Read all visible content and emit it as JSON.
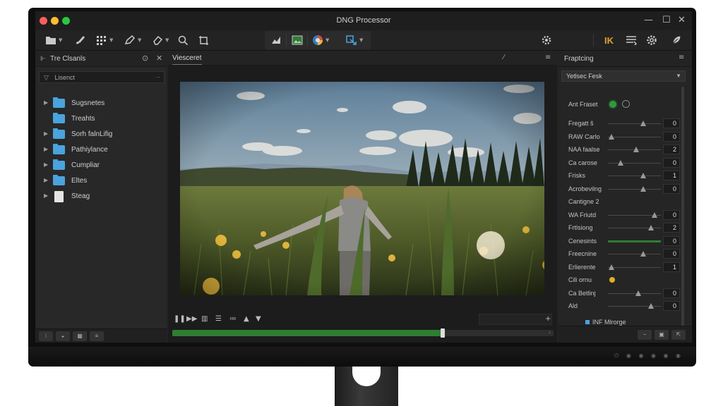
{
  "window": {
    "title": "DNG Processor",
    "controls": [
      "—",
      "☐",
      "✕"
    ]
  },
  "traffic_lights": [
    "#ff5f57",
    "#febc2e",
    "#28c840"
  ],
  "toolbar": {
    "icons_left": [
      "folder-icon",
      "brush-icon",
      "grid-icon",
      "pen-icon",
      "eraser-icon",
      "zoom-icon",
      "crop-icon"
    ],
    "icons_center": [
      "histogram-icon",
      "image-icon",
      "color-wheel-icon",
      "export-icon"
    ],
    "icons_right": [
      "settings-icon",
      "ik-logo-icon",
      "layers-icon",
      "gear-icon",
      "feather-icon"
    ],
    "ik_label": "IK"
  },
  "left_panel": {
    "title": "Tre Clsanls",
    "filter_label": "Lisenct",
    "items": [
      {
        "label": "Sugsnetes",
        "expandable": true,
        "type": "folder"
      },
      {
        "label": "Treahts",
        "expandable": false,
        "type": "folder"
      },
      {
        "label": "Sorh falnLifig",
        "expandable": true,
        "type": "folder"
      },
      {
        "label": "Pathiylance",
        "expandable": true,
        "type": "folder"
      },
      {
        "label": "Cumpliar",
        "expandable": true,
        "type": "folder"
      },
      {
        "label": "Eltes",
        "expandable": true,
        "type": "folder"
      },
      {
        "label": "Steag",
        "expandable": true,
        "type": "document"
      }
    ]
  },
  "viewer": {
    "tab_label": "Viesceret"
  },
  "playback": {
    "progress": 0.71
  },
  "right_panel": {
    "title": "Fraptcing",
    "preset_label": "Yetlsec Fesk",
    "auto_preset_label": "Ant Fraset",
    "params": [
      {
        "label": "Fregatt š",
        "value": "0",
        "pos": 0.65,
        "fill": false
      },
      {
        "label": "RAW Carlo",
        "value": "0",
        "pos": 0.02,
        "fill": false
      },
      {
        "label": "NAA faalse",
        "value": "2",
        "pos": 0.5,
        "fill": false
      },
      {
        "label": "Ca carose",
        "value": "0",
        "pos": 0.2,
        "fill": false
      },
      {
        "label": "Frisks",
        "value": "1",
        "pos": 0.65,
        "fill": false
      },
      {
        "label": "Acrobevilng",
        "value": "0",
        "pos": 0.65,
        "fill": false
      },
      {
        "label": "Cantigne 2",
        "value": "",
        "pos": null,
        "fill": false
      },
      {
        "label": "WA Friutd",
        "value": "0",
        "pos": 0.88,
        "fill": false
      },
      {
        "label": "Frtlsiong",
        "value": "2",
        "pos": 0.8,
        "fill": false
      },
      {
        "label": "Cenesints",
        "value": "0",
        "pos": 1.0,
        "fill": true
      },
      {
        "label": "Freecnine",
        "value": "0",
        "pos": 0.65,
        "fill": false
      },
      {
        "label": "Erlierente",
        "value": "1",
        "pos": 0.02,
        "fill": false
      },
      {
        "label": "Cili ornu",
        "value": "",
        "pos": null,
        "fill": false
      },
      {
        "label": "Ca Betlinj",
        "value": "0",
        "pos": 0.55,
        "fill": false
      },
      {
        "label": "Ald",
        "value": "0",
        "pos": 0.8,
        "fill": false
      }
    ],
    "footer_label": "INF Mlrorge"
  }
}
